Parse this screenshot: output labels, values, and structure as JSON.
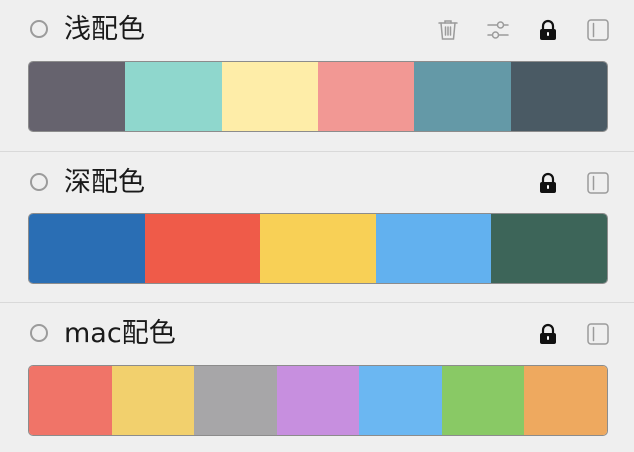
{
  "schemes": [
    {
      "title": "浅配色",
      "colors": [
        "#66636e",
        "#8fd7cd",
        "#feeda8",
        "#f29894",
        "#6499a7",
        "#4a5a64"
      ],
      "icons": [
        "trash-icon",
        "sliders-icon",
        "lock-icon",
        "sidebar-icon"
      ]
    },
    {
      "title": "深配色",
      "colors": [
        "#2a6eb4",
        "#ef5b49",
        "#f8d056",
        "#62b1ef",
        "#3d6559"
      ],
      "icons": [
        "lock-icon",
        "sidebar-icon"
      ]
    },
    {
      "title": "mac配色",
      "colors": [
        "#f07468",
        "#f2d06d",
        "#a7a6a8",
        "#c78fdf",
        "#6bb7f2",
        "#89c965",
        "#eea95f"
      ],
      "icons": [
        "lock-icon",
        "sidebar-icon"
      ]
    }
  ]
}
